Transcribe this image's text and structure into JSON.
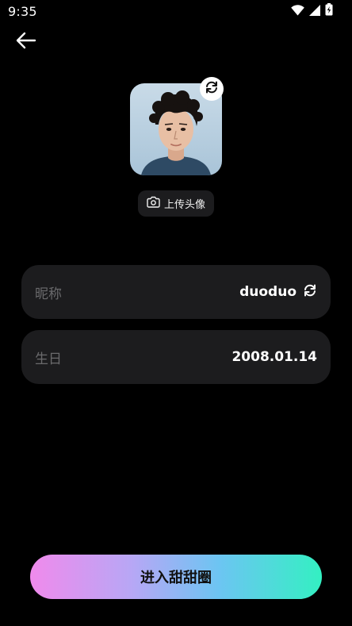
{
  "status_bar": {
    "time": "9:35",
    "icons": [
      "wifi-icon",
      "cellular-signal-icon",
      "battery-icon"
    ]
  },
  "header": {
    "back_icon": "arrow-left-icon"
  },
  "avatar": {
    "swap_icon": "refresh-icon",
    "upload_label": "上传头像",
    "upload_icon": "camera-icon"
  },
  "fields": {
    "nickname_label": "昵称",
    "nickname_value": "duoduo",
    "nickname_icon": "refresh-icon",
    "birthday_label": "生日",
    "birthday_value": "2008.01.14"
  },
  "enter_button": {
    "label": "进入甜甜圈"
  },
  "colors": {
    "background": "#000000",
    "card": "#1c1c1e",
    "label": "#6a6a6c",
    "gradient": [
      "#f08aec",
      "#b7a7f5",
      "#6cc5f2",
      "#33f0c2"
    ]
  }
}
